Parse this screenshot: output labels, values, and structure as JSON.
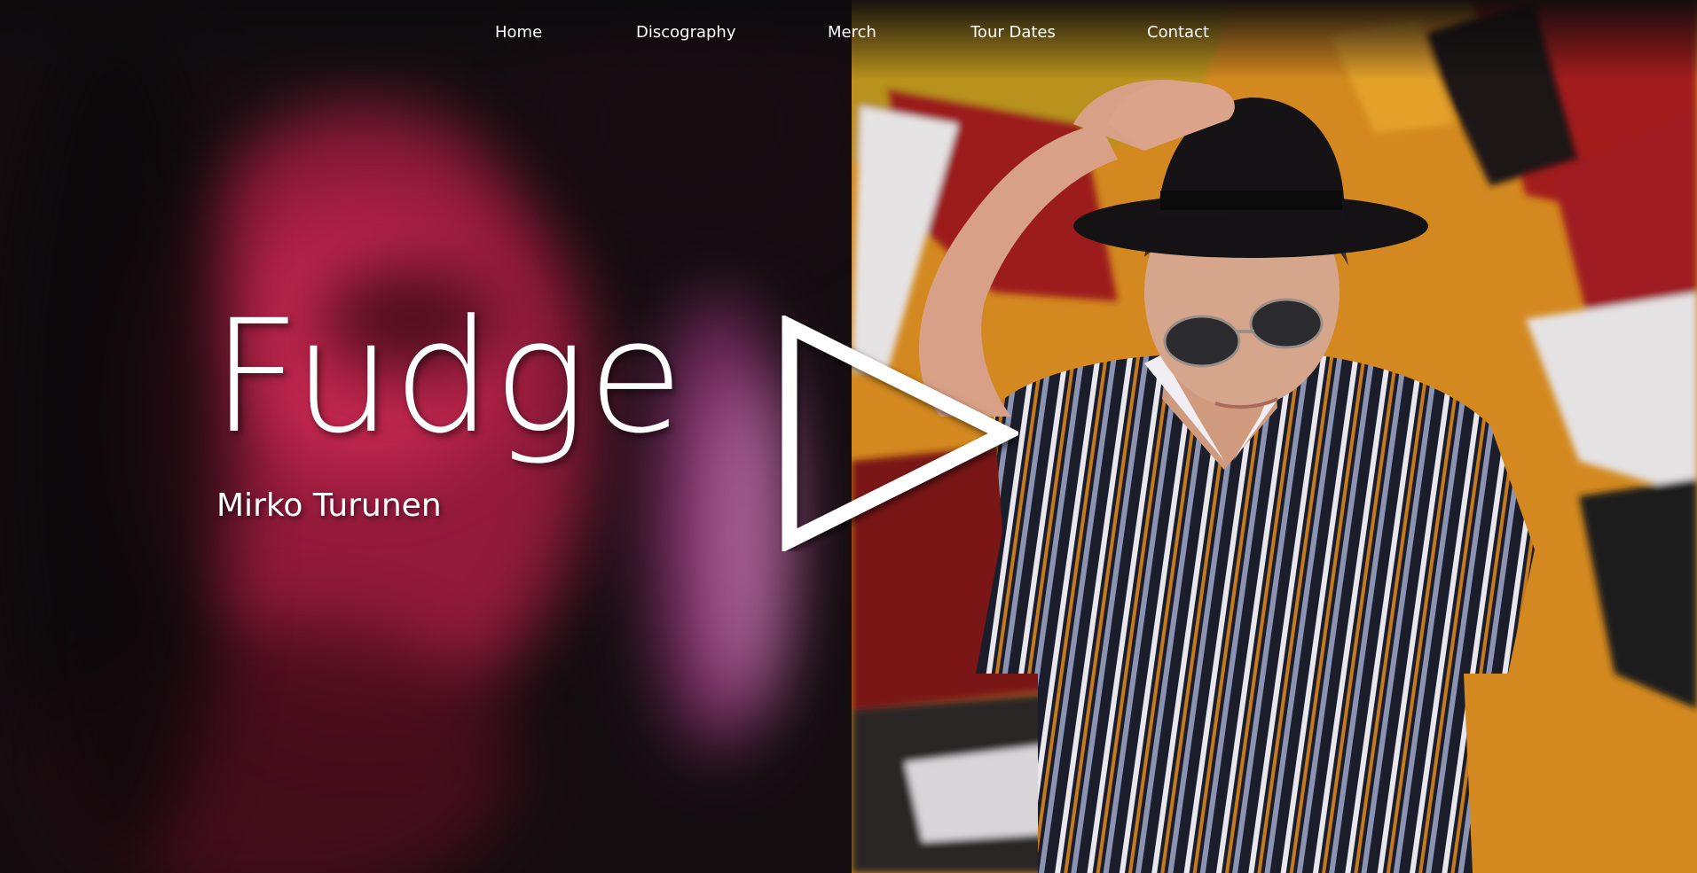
{
  "nav": {
    "items": [
      {
        "label": "Home"
      },
      {
        "label": "Discography"
      },
      {
        "label": "Merch"
      },
      {
        "label": "Tour Dates"
      },
      {
        "label": "Contact"
      }
    ]
  },
  "hero": {
    "title": "Fudge",
    "subtitle": "Mirko Turunen",
    "play_icon": "play-icon"
  },
  "colors": {
    "text": "#ffffff",
    "left_panel_tint": "#c3264d",
    "right_panel_wall": "#d08a1c"
  }
}
